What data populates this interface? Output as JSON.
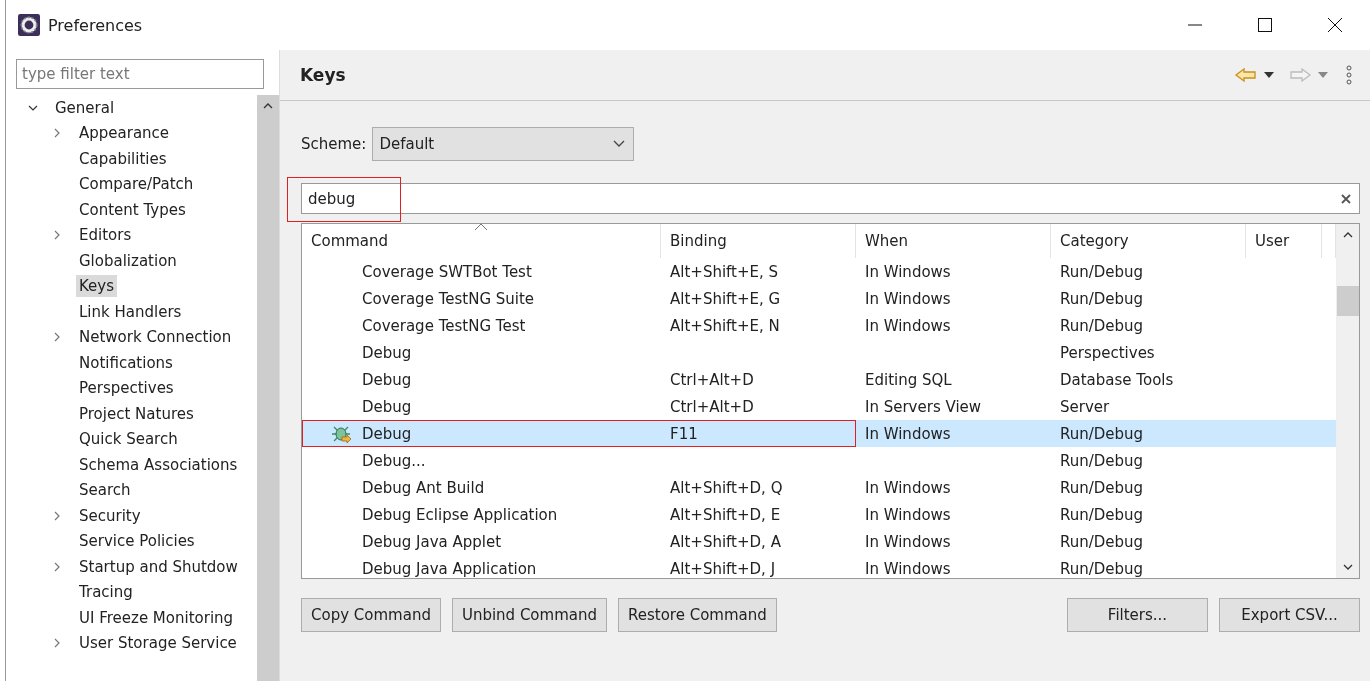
{
  "window": {
    "title": "Preferences"
  },
  "filter": {
    "placeholder": "type filter text"
  },
  "tree": [
    {
      "label": "General",
      "expanded": true,
      "selected": false,
      "children": [
        {
          "label": "Appearance",
          "expanded": false,
          "selected": false
        },
        {
          "label": "Capabilities",
          "selected": false
        },
        {
          "label": "Compare/Patch",
          "selected": false
        },
        {
          "label": "Content Types",
          "selected": false
        },
        {
          "label": "Editors",
          "expanded": false,
          "selected": false
        },
        {
          "label": "Globalization",
          "selected": false
        },
        {
          "label": "Keys",
          "selected": true
        },
        {
          "label": "Link Handlers",
          "selected": false
        },
        {
          "label": "Network Connection",
          "expanded": false,
          "selected": false
        },
        {
          "label": "Notifications",
          "selected": false
        },
        {
          "label": "Perspectives",
          "selected": false
        },
        {
          "label": "Project Natures",
          "selected": false
        },
        {
          "label": "Quick Search",
          "selected": false
        },
        {
          "label": "Schema Associations",
          "selected": false
        },
        {
          "label": "Search",
          "selected": false
        },
        {
          "label": "Security",
          "expanded": false,
          "selected": false
        },
        {
          "label": "Service Policies",
          "selected": false
        },
        {
          "label": "Startup and Shutdow",
          "expanded": false,
          "selected": false
        },
        {
          "label": "Tracing",
          "selected": false
        },
        {
          "label": "UI Freeze Monitoring",
          "selected": false
        },
        {
          "label": "User Storage Service",
          "expanded": false,
          "selected": false
        }
      ]
    }
  ],
  "page": {
    "title": "Keys",
    "scheme_label": "Scheme:",
    "scheme": "Default",
    "search": {
      "value": "debug",
      "annotated": true
    }
  },
  "table": {
    "columns": [
      "Command",
      "Binding",
      "When",
      "Category",
      "User"
    ],
    "rows": [
      {
        "command": "Coverage SWTBot Test",
        "binding": "Alt+Shift+E, S",
        "when": "In Windows",
        "category": "Run/Debug",
        "selected": false,
        "annotated": false
      },
      {
        "command": "Coverage TestNG Suite",
        "binding": "Alt+Shift+E, G",
        "when": "In Windows",
        "category": "Run/Debug",
        "selected": false,
        "annotated": false
      },
      {
        "command": "Coverage TestNG Test",
        "binding": "Alt+Shift+E, N",
        "when": "In Windows",
        "category": "Run/Debug",
        "selected": false,
        "annotated": false
      },
      {
        "command": "Debug",
        "category": "Perspectives",
        "selected": false,
        "annotated": false
      },
      {
        "command": "Debug",
        "binding": "Ctrl+Alt+D",
        "when": "Editing SQL",
        "category": "Database Tools",
        "selected": false,
        "annotated": false
      },
      {
        "command": "Debug",
        "binding": "Ctrl+Alt+D",
        "when": "In Servers View",
        "category": "Server",
        "selected": false,
        "annotated": false
      },
      {
        "command": "Debug",
        "binding": "F11",
        "when": "In Windows",
        "category": "Run/Debug",
        "selected": true,
        "annotated": true,
        "kind": "debug-icon"
      },
      {
        "command": "Debug...",
        "category": "Run/Debug",
        "selected": false,
        "annotated": false
      },
      {
        "command": "Debug Ant Build",
        "binding": "Alt+Shift+D, Q",
        "when": "In Windows",
        "category": "Run/Debug",
        "selected": false,
        "annotated": false
      },
      {
        "command": "Debug Eclipse Application",
        "binding": "Alt+Shift+D, E",
        "when": "In Windows",
        "category": "Run/Debug",
        "selected": false,
        "annotated": false
      },
      {
        "command": "Debug Java Applet",
        "binding": "Alt+Shift+D, A",
        "when": "In Windows",
        "category": "Run/Debug",
        "selected": false,
        "annotated": false
      },
      {
        "command": "Debug Java Application",
        "binding": "Alt+Shift+D, J",
        "when": "In Windows",
        "category": "Run/Debug",
        "selected": false,
        "annotated": false
      }
    ]
  },
  "buttons_left": [
    "Copy Command",
    "Unbind Command",
    "Restore Command"
  ],
  "buttons_right": [
    "Filters...",
    "Export CSV..."
  ]
}
